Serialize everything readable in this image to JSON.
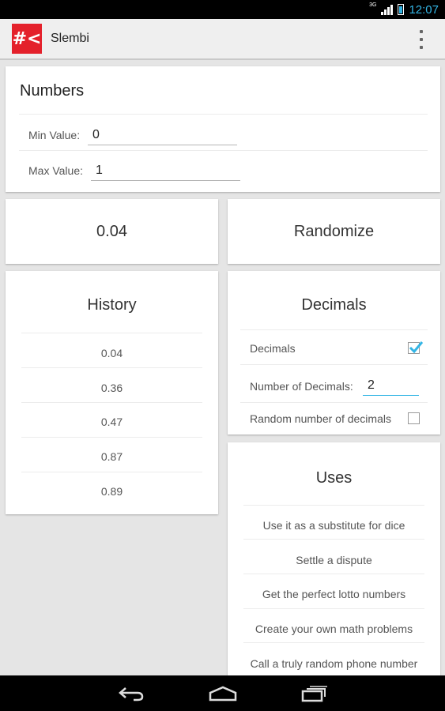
{
  "status_bar": {
    "network": "3G",
    "time": "12:07"
  },
  "action_bar": {
    "logo_text": "#<",
    "title": "Slembi"
  },
  "numbers": {
    "title": "Numbers",
    "min_label": "Min Value:",
    "min_value": "0",
    "max_label": "Max Value:",
    "max_value": "1"
  },
  "result": {
    "value": "0.04"
  },
  "randomize": {
    "label": "Randomize"
  },
  "history": {
    "title": "History",
    "items": [
      "0.04",
      "0.36",
      "0.47",
      "0.87",
      "0.89"
    ]
  },
  "decimals": {
    "title": "Decimals",
    "decimals_label": "Decimals",
    "decimals_checked": true,
    "count_label": "Number of Decimals:",
    "count_value": "2",
    "random_label": "Random number of decimals",
    "random_checked": false
  },
  "uses": {
    "title": "Uses",
    "items": [
      "Use it as a substitute for dice",
      "Settle a dispute",
      "Get the perfect lotto numbers",
      "Create your own math problems",
      "Call a truly random phone number"
    ]
  },
  "colors": {
    "accent": "#33b5e5",
    "brand": "#e4212b"
  },
  "icons": {
    "back": "back-icon",
    "home": "home-icon",
    "recents": "recents-icon",
    "overflow": "overflow-menu-icon"
  }
}
